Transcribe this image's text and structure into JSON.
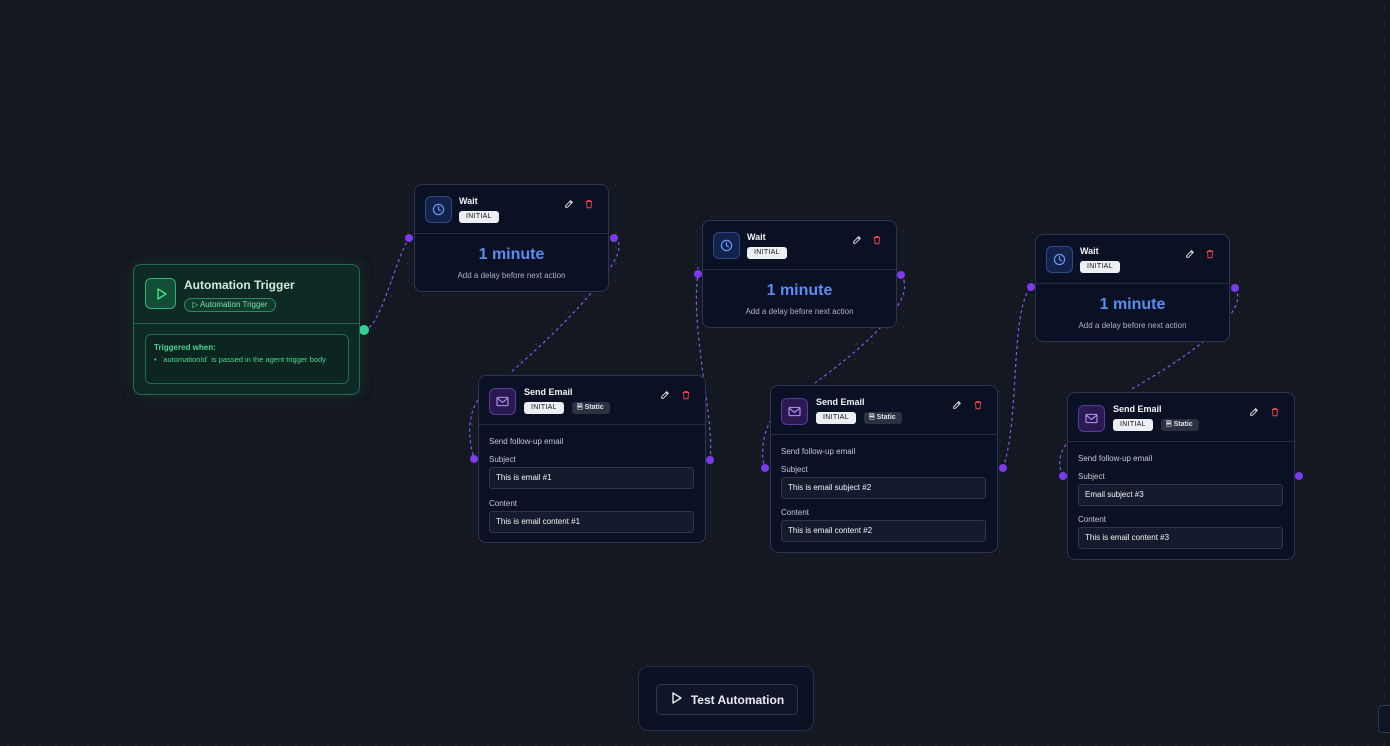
{
  "trigger": {
    "title": "Automation Trigger",
    "badge": "Automation Trigger",
    "condition_title": "Triggered when:",
    "condition": "`automationId` is passed in the agent trigger body"
  },
  "wait_nodes": [
    {
      "title": "Wait",
      "status": "INITIAL",
      "duration": "1 minute",
      "description": "Add a delay before next action"
    },
    {
      "title": "Wait",
      "status": "INITIAL",
      "duration": "1 minute",
      "description": "Add a delay before next action"
    },
    {
      "title": "Wait",
      "status": "INITIAL",
      "duration": "1 minute",
      "description": "Add a delay before next action"
    }
  ],
  "email_nodes": [
    {
      "title": "Send Email",
      "status": "INITIAL",
      "type": "Static",
      "description": "Send follow-up email",
      "subject_label": "Subject",
      "subject": "This is email #1",
      "content_label": "Content",
      "content": "This is email content #1"
    },
    {
      "title": "Send Email",
      "status": "INITIAL",
      "type": "Static",
      "description": "Send follow-up email",
      "subject_label": "Subject",
      "subject": "This is email subject #2",
      "content_label": "Content",
      "content": "This is email content #2"
    },
    {
      "title": "Send Email",
      "status": "INITIAL",
      "type": "Static",
      "description": "Send follow-up email",
      "subject_label": "Subject",
      "subject": "Email subject #3",
      "content_label": "Content",
      "content": "This is email content #3"
    }
  ],
  "test_button": {
    "label": "Test Automation"
  },
  "icons": {
    "trigger": "play-icon",
    "wait": "clock-icon",
    "email": "mail-icon",
    "edit": "edit-icon",
    "delete": "trash-icon",
    "static": "document-icon",
    "test": "play-icon"
  },
  "colors": {
    "background": "#141821",
    "trigger_accent": "#22c55e",
    "wait_duration": "#5b8cf0",
    "edge": "#7c4dff",
    "delete": "#ef4444"
  }
}
